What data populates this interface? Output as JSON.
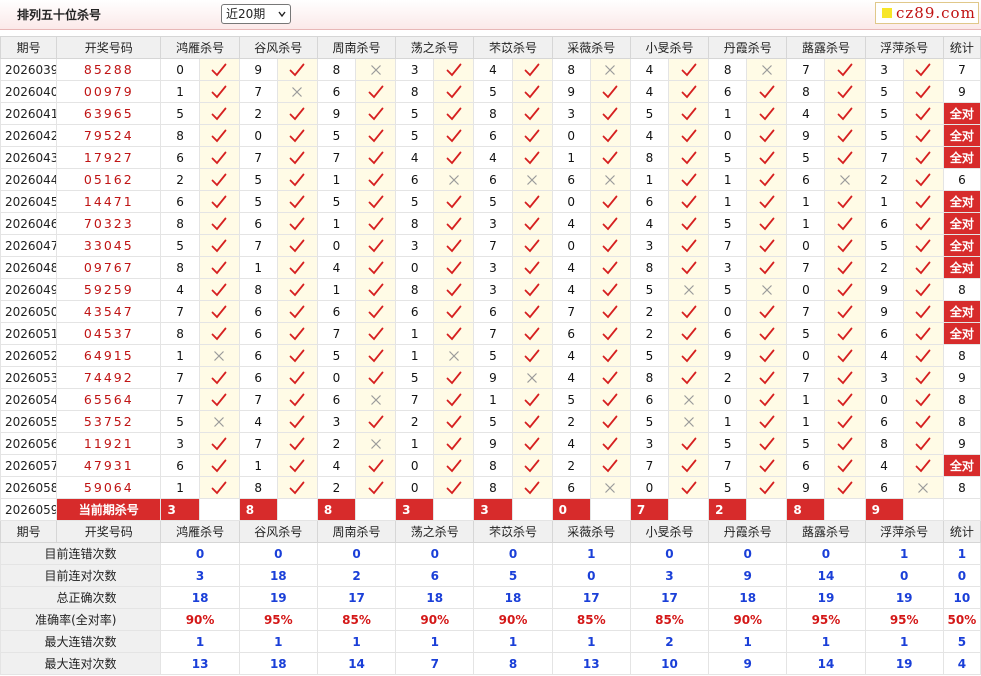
{
  "header": {
    "title": "排列五十位杀号",
    "period_select": "近20期",
    "logo": "cz89.com"
  },
  "columns": {
    "period": "期号",
    "draw": "开奖号码",
    "experts": [
      "鸿雁杀号",
      "谷风杀号",
      "周南杀号",
      "荡之杀号",
      "芣苡杀号",
      "采薇杀号",
      "小旻杀号",
      "丹霞杀号",
      "蕗露杀号",
      "浮萍杀号"
    ],
    "total": "统计"
  },
  "marks": {
    "correct": "✓",
    "wrong": "✕",
    "all_correct": "全对"
  },
  "colors": {
    "accent_red": "#d72b2b",
    "stat_blue": "#1a3fd8",
    "mark_bg": "#fffbe6"
  },
  "rows": [
    {
      "period": "2026039",
      "draw": "85288",
      "picks": [
        {
          "n": "0",
          "ok": true
        },
        {
          "n": "9",
          "ok": true
        },
        {
          "n": "8",
          "ok": false
        },
        {
          "n": "3",
          "ok": true
        },
        {
          "n": "4",
          "ok": true
        },
        {
          "n": "8",
          "ok": false
        },
        {
          "n": "4",
          "ok": true
        },
        {
          "n": "8",
          "ok": false
        },
        {
          "n": "7",
          "ok": true
        },
        {
          "n": "3",
          "ok": true
        }
      ],
      "total": "7"
    },
    {
      "period": "2026040",
      "draw": "00979",
      "picks": [
        {
          "n": "1",
          "ok": true
        },
        {
          "n": "7",
          "ok": false
        },
        {
          "n": "6",
          "ok": true
        },
        {
          "n": "8",
          "ok": true
        },
        {
          "n": "5",
          "ok": true
        },
        {
          "n": "9",
          "ok": true
        },
        {
          "n": "4",
          "ok": true
        },
        {
          "n": "6",
          "ok": true
        },
        {
          "n": "8",
          "ok": true
        },
        {
          "n": "5",
          "ok": true
        }
      ],
      "total": "9"
    },
    {
      "period": "2026041",
      "draw": "63965",
      "picks": [
        {
          "n": "5",
          "ok": true
        },
        {
          "n": "2",
          "ok": true
        },
        {
          "n": "9",
          "ok": true
        },
        {
          "n": "5",
          "ok": true
        },
        {
          "n": "8",
          "ok": true
        },
        {
          "n": "3",
          "ok": true
        },
        {
          "n": "5",
          "ok": true
        },
        {
          "n": "1",
          "ok": true
        },
        {
          "n": "4",
          "ok": true
        },
        {
          "n": "5",
          "ok": true
        }
      ],
      "total": "全对"
    },
    {
      "period": "2026042",
      "draw": "79524",
      "picks": [
        {
          "n": "8",
          "ok": true
        },
        {
          "n": "0",
          "ok": true
        },
        {
          "n": "5",
          "ok": true
        },
        {
          "n": "5",
          "ok": true
        },
        {
          "n": "6",
          "ok": true
        },
        {
          "n": "0",
          "ok": true
        },
        {
          "n": "4",
          "ok": true
        },
        {
          "n": "0",
          "ok": true
        },
        {
          "n": "9",
          "ok": true
        },
        {
          "n": "5",
          "ok": true
        }
      ],
      "total": "全对"
    },
    {
      "period": "2026043",
      "draw": "17927",
      "picks": [
        {
          "n": "6",
          "ok": true
        },
        {
          "n": "7",
          "ok": true
        },
        {
          "n": "7",
          "ok": true
        },
        {
          "n": "4",
          "ok": true
        },
        {
          "n": "4",
          "ok": true
        },
        {
          "n": "1",
          "ok": true
        },
        {
          "n": "8",
          "ok": true
        },
        {
          "n": "5",
          "ok": true
        },
        {
          "n": "5",
          "ok": true
        },
        {
          "n": "7",
          "ok": true
        }
      ],
      "total": "全对"
    },
    {
      "period": "2026044",
      "draw": "05162",
      "picks": [
        {
          "n": "2",
          "ok": true
        },
        {
          "n": "5",
          "ok": true
        },
        {
          "n": "1",
          "ok": true
        },
        {
          "n": "6",
          "ok": false
        },
        {
          "n": "6",
          "ok": false
        },
        {
          "n": "6",
          "ok": false
        },
        {
          "n": "1",
          "ok": true
        },
        {
          "n": "1",
          "ok": true
        },
        {
          "n": "6",
          "ok": false
        },
        {
          "n": "2",
          "ok": true
        }
      ],
      "total": "6"
    },
    {
      "period": "2026045",
      "draw": "14471",
      "picks": [
        {
          "n": "6",
          "ok": true
        },
        {
          "n": "5",
          "ok": true
        },
        {
          "n": "5",
          "ok": true
        },
        {
          "n": "5",
          "ok": true
        },
        {
          "n": "5",
          "ok": true
        },
        {
          "n": "0",
          "ok": true
        },
        {
          "n": "6",
          "ok": true
        },
        {
          "n": "1",
          "ok": true
        },
        {
          "n": "1",
          "ok": true
        },
        {
          "n": "1",
          "ok": true
        }
      ],
      "total": "全对"
    },
    {
      "period": "2026046",
      "draw": "70323",
      "picks": [
        {
          "n": "8",
          "ok": true
        },
        {
          "n": "6",
          "ok": true
        },
        {
          "n": "1",
          "ok": true
        },
        {
          "n": "8",
          "ok": true
        },
        {
          "n": "3",
          "ok": true
        },
        {
          "n": "4",
          "ok": true
        },
        {
          "n": "4",
          "ok": true
        },
        {
          "n": "5",
          "ok": true
        },
        {
          "n": "1",
          "ok": true
        },
        {
          "n": "6",
          "ok": true
        }
      ],
      "total": "全对"
    },
    {
      "period": "2026047",
      "draw": "33045",
      "picks": [
        {
          "n": "5",
          "ok": true
        },
        {
          "n": "7",
          "ok": true
        },
        {
          "n": "0",
          "ok": true
        },
        {
          "n": "3",
          "ok": true
        },
        {
          "n": "7",
          "ok": true
        },
        {
          "n": "0",
          "ok": true
        },
        {
          "n": "3",
          "ok": true
        },
        {
          "n": "7",
          "ok": true
        },
        {
          "n": "0",
          "ok": true
        },
        {
          "n": "5",
          "ok": true
        }
      ],
      "total": "全对"
    },
    {
      "period": "2026048",
      "draw": "09767",
      "picks": [
        {
          "n": "8",
          "ok": true
        },
        {
          "n": "1",
          "ok": true
        },
        {
          "n": "4",
          "ok": true
        },
        {
          "n": "0",
          "ok": true
        },
        {
          "n": "3",
          "ok": true
        },
        {
          "n": "4",
          "ok": true
        },
        {
          "n": "8",
          "ok": true
        },
        {
          "n": "3",
          "ok": true
        },
        {
          "n": "7",
          "ok": true
        },
        {
          "n": "2",
          "ok": true
        }
      ],
      "total": "全对"
    },
    {
      "period": "2026049",
      "draw": "59259",
      "picks": [
        {
          "n": "4",
          "ok": true
        },
        {
          "n": "8",
          "ok": true
        },
        {
          "n": "1",
          "ok": true
        },
        {
          "n": "8",
          "ok": true
        },
        {
          "n": "3",
          "ok": true
        },
        {
          "n": "4",
          "ok": true
        },
        {
          "n": "5",
          "ok": false
        },
        {
          "n": "5",
          "ok": false
        },
        {
          "n": "0",
          "ok": true
        },
        {
          "n": "9",
          "ok": true
        }
      ],
      "total": "8"
    },
    {
      "period": "2026050",
      "draw": "43547",
      "picks": [
        {
          "n": "7",
          "ok": true
        },
        {
          "n": "6",
          "ok": true
        },
        {
          "n": "6",
          "ok": true
        },
        {
          "n": "6",
          "ok": true
        },
        {
          "n": "6",
          "ok": true
        },
        {
          "n": "7",
          "ok": true
        },
        {
          "n": "2",
          "ok": true
        },
        {
          "n": "0",
          "ok": true
        },
        {
          "n": "7",
          "ok": true
        },
        {
          "n": "9",
          "ok": true
        }
      ],
      "total": "全对"
    },
    {
      "period": "2026051",
      "draw": "04537",
      "picks": [
        {
          "n": "8",
          "ok": true
        },
        {
          "n": "6",
          "ok": true
        },
        {
          "n": "7",
          "ok": true
        },
        {
          "n": "1",
          "ok": true
        },
        {
          "n": "7",
          "ok": true
        },
        {
          "n": "6",
          "ok": true
        },
        {
          "n": "2",
          "ok": true
        },
        {
          "n": "6",
          "ok": true
        },
        {
          "n": "5",
          "ok": true
        },
        {
          "n": "6",
          "ok": true
        }
      ],
      "total": "全对"
    },
    {
      "period": "2026052",
      "draw": "64915",
      "picks": [
        {
          "n": "1",
          "ok": false
        },
        {
          "n": "6",
          "ok": true
        },
        {
          "n": "5",
          "ok": true
        },
        {
          "n": "1",
          "ok": false
        },
        {
          "n": "5",
          "ok": true
        },
        {
          "n": "4",
          "ok": true
        },
        {
          "n": "5",
          "ok": true
        },
        {
          "n": "9",
          "ok": true
        },
        {
          "n": "0",
          "ok": true
        },
        {
          "n": "4",
          "ok": true
        }
      ],
      "total": "8"
    },
    {
      "period": "2026053",
      "draw": "74492",
      "picks": [
        {
          "n": "7",
          "ok": true
        },
        {
          "n": "6",
          "ok": true
        },
        {
          "n": "0",
          "ok": true
        },
        {
          "n": "5",
          "ok": true
        },
        {
          "n": "9",
          "ok": false
        },
        {
          "n": "4",
          "ok": true
        },
        {
          "n": "8",
          "ok": true
        },
        {
          "n": "2",
          "ok": true
        },
        {
          "n": "7",
          "ok": true
        },
        {
          "n": "3",
          "ok": true
        }
      ],
      "total": "9"
    },
    {
      "period": "2026054",
      "draw": "65564",
      "picks": [
        {
          "n": "7",
          "ok": true
        },
        {
          "n": "7",
          "ok": true
        },
        {
          "n": "6",
          "ok": false
        },
        {
          "n": "7",
          "ok": true
        },
        {
          "n": "1",
          "ok": true
        },
        {
          "n": "5",
          "ok": true
        },
        {
          "n": "6",
          "ok": false
        },
        {
          "n": "0",
          "ok": true
        },
        {
          "n": "1",
          "ok": true
        },
        {
          "n": "0",
          "ok": true
        }
      ],
      "total": "8"
    },
    {
      "period": "2026055",
      "draw": "53752",
      "picks": [
        {
          "n": "5",
          "ok": false
        },
        {
          "n": "4",
          "ok": true
        },
        {
          "n": "3",
          "ok": true
        },
        {
          "n": "2",
          "ok": true
        },
        {
          "n": "5",
          "ok": true
        },
        {
          "n": "2",
          "ok": true
        },
        {
          "n": "5",
          "ok": false
        },
        {
          "n": "1",
          "ok": true
        },
        {
          "n": "1",
          "ok": true
        },
        {
          "n": "6",
          "ok": true
        }
      ],
      "total": "8"
    },
    {
      "period": "2026056",
      "draw": "11921",
      "picks": [
        {
          "n": "3",
          "ok": true
        },
        {
          "n": "7",
          "ok": true
        },
        {
          "n": "2",
          "ok": false
        },
        {
          "n": "1",
          "ok": true
        },
        {
          "n": "9",
          "ok": true
        },
        {
          "n": "4",
          "ok": true
        },
        {
          "n": "3",
          "ok": true
        },
        {
          "n": "5",
          "ok": true
        },
        {
          "n": "5",
          "ok": true
        },
        {
          "n": "8",
          "ok": true
        }
      ],
      "total": "9"
    },
    {
      "period": "2026057",
      "draw": "47931",
      "picks": [
        {
          "n": "6",
          "ok": true
        },
        {
          "n": "1",
          "ok": true
        },
        {
          "n": "4",
          "ok": true
        },
        {
          "n": "0",
          "ok": true
        },
        {
          "n": "8",
          "ok": true
        },
        {
          "n": "2",
          "ok": true
        },
        {
          "n": "7",
          "ok": true
        },
        {
          "n": "7",
          "ok": true
        },
        {
          "n": "6",
          "ok": true
        },
        {
          "n": "4",
          "ok": true
        }
      ],
      "total": "全对"
    },
    {
      "period": "2026058",
      "draw": "59064",
      "picks": [
        {
          "n": "1",
          "ok": true
        },
        {
          "n": "8",
          "ok": true
        },
        {
          "n": "2",
          "ok": true
        },
        {
          "n": "0",
          "ok": true
        },
        {
          "n": "8",
          "ok": true
        },
        {
          "n": "6",
          "ok": false
        },
        {
          "n": "0",
          "ok": true
        },
        {
          "n": "5",
          "ok": true
        },
        {
          "n": "9",
          "ok": true
        },
        {
          "n": "6",
          "ok": false
        }
      ],
      "total": "8"
    }
  ],
  "current": {
    "period": "2026059",
    "label": "当前期杀号",
    "picks": [
      "3",
      "8",
      "8",
      "3",
      "3",
      "0",
      "7",
      "2",
      "8",
      "9"
    ]
  },
  "stats": [
    {
      "label": "目前连错次数",
      "values": [
        "0",
        "0",
        "0",
        "0",
        "0",
        "1",
        "0",
        "0",
        "0",
        "1",
        "1"
      ],
      "color": "blue"
    },
    {
      "label": "目前连对次数",
      "values": [
        "3",
        "18",
        "2",
        "6",
        "5",
        "0",
        "3",
        "9",
        "14",
        "0",
        "0"
      ],
      "color": "blue"
    },
    {
      "label": "总正确次数",
      "values": [
        "18",
        "19",
        "17",
        "18",
        "18",
        "17",
        "17",
        "18",
        "19",
        "19",
        "10"
      ],
      "color": "blue"
    },
    {
      "label": "准确率(全对率)",
      "values": [
        "90%",
        "95%",
        "85%",
        "90%",
        "90%",
        "85%",
        "85%",
        "90%",
        "95%",
        "95%",
        "50%"
      ],
      "color": "red"
    },
    {
      "label": "最大连错次数",
      "values": [
        "1",
        "1",
        "1",
        "1",
        "1",
        "1",
        "2",
        "1",
        "1",
        "1",
        "5"
      ],
      "color": "blue"
    },
    {
      "label": "最大连对次数",
      "values": [
        "13",
        "18",
        "14",
        "7",
        "8",
        "13",
        "10",
        "9",
        "14",
        "19",
        "4"
      ],
      "color": "blue"
    }
  ]
}
